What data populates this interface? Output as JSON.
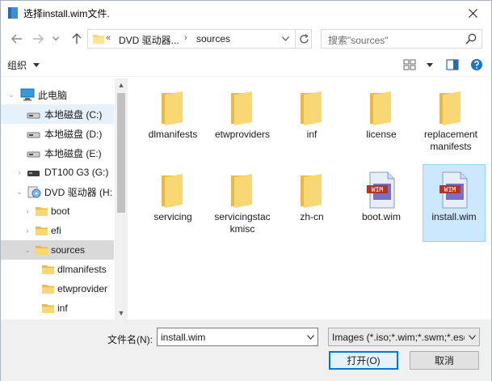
{
  "window": {
    "title": "选择install.wim文件."
  },
  "address": {
    "overflow": "«",
    "segments": [
      "DVD 驱动器...",
      "sources"
    ]
  },
  "search": {
    "placeholder": "搜索\"sources\""
  },
  "toolbar": {
    "organize_label": "组织"
  },
  "nav_tree": [
    {
      "label": "此电脑",
      "icon": "computer-icon",
      "state": "normal"
    },
    {
      "label": "本地磁盘 (C:)",
      "icon": "drive-icon",
      "state": "hover"
    },
    {
      "label": "本地磁盘 (D:)",
      "icon": "drive-icon",
      "state": "normal"
    },
    {
      "label": "本地磁盘 (E:)",
      "icon": "drive-icon",
      "state": "normal"
    },
    {
      "label": "DT100 G3 (G:)",
      "icon": "usb-drive-icon",
      "state": "normal"
    },
    {
      "label": "DVD 驱动器 (H:",
      "icon": "dvd-drive-icon",
      "state": "normal"
    },
    {
      "label": "boot",
      "icon": "folder-icon",
      "state": "normal"
    },
    {
      "label": "efi",
      "icon": "folder-icon",
      "state": "normal"
    },
    {
      "label": "sources",
      "icon": "folder-icon",
      "state": "selected"
    },
    {
      "label": "dlmanifests",
      "icon": "folder-icon",
      "state": "normal"
    },
    {
      "label": "etwprovider",
      "icon": "folder-icon",
      "state": "normal"
    },
    {
      "label": "inf",
      "icon": "folder-icon",
      "state": "normal"
    }
  ],
  "files": [
    {
      "name": "dlmanifests",
      "type": "folder"
    },
    {
      "name": "etwproviders",
      "type": "folder"
    },
    {
      "name": "inf",
      "type": "folder"
    },
    {
      "name": "license",
      "type": "folder"
    },
    {
      "name": "replacementmanifests",
      "type": "folder"
    },
    {
      "name": "servicing",
      "type": "folder"
    },
    {
      "name": "servicingstackmisc",
      "type": "folder"
    },
    {
      "name": "zh-cn",
      "type": "folder"
    },
    {
      "name": "boot.wim",
      "type": "wim"
    },
    {
      "name": "install.wim",
      "type": "wim"
    }
  ],
  "selected_file": "install.wim",
  "wim_icon_text": "WIM",
  "bottom": {
    "filename_label": "文件名(N):",
    "filename_value": "install.wim",
    "filetype_value": "Images (*.iso;*.wim;*.swm;*.esd)",
    "open_label": "打开(O)",
    "cancel_label": "取消"
  },
  "colors": {
    "accent": "#0078d7",
    "folder": "#f8d775",
    "selection": "#cce8ff",
    "nav_selected": "#d9d9d9"
  }
}
